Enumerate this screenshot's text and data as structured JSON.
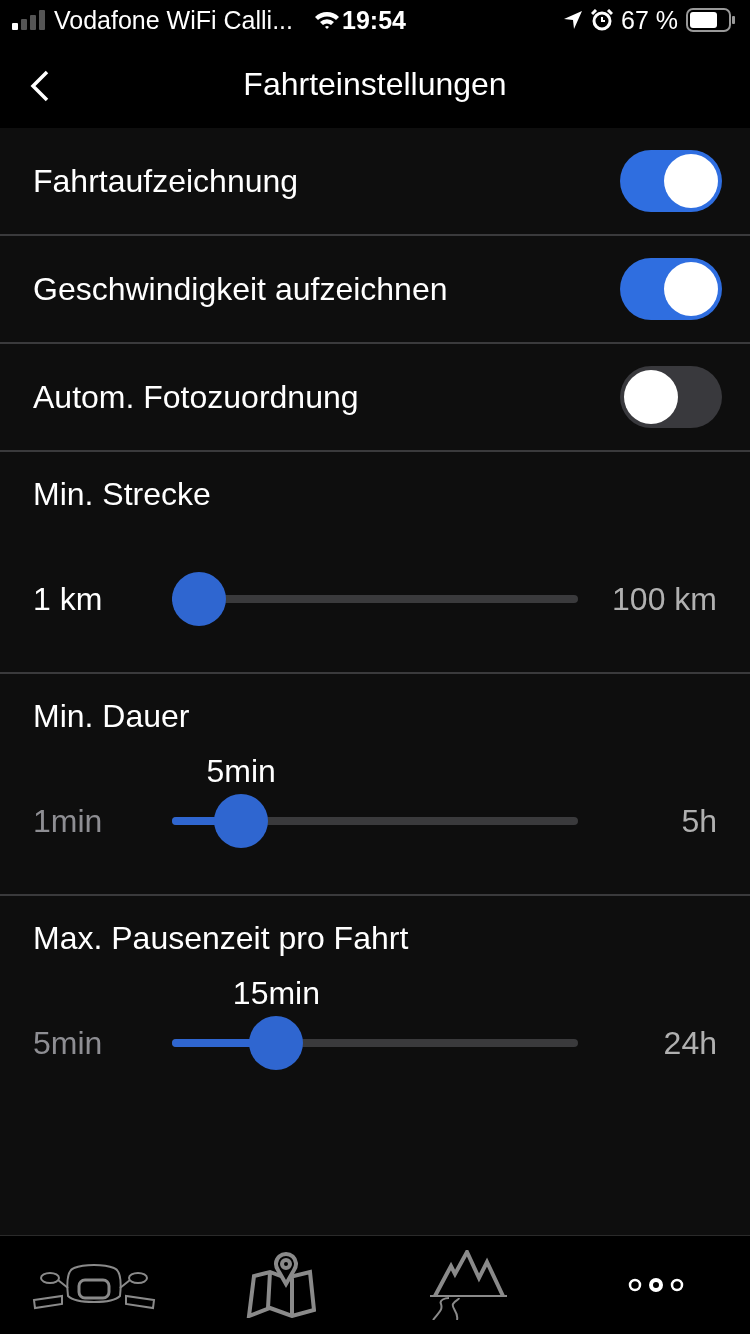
{
  "status_bar": {
    "carrier": "Vodafone WiFi Calli...",
    "time": "19:54",
    "battery": "67 %"
  },
  "nav": {
    "title": "Fahrteinstellungen"
  },
  "toggles": [
    {
      "label": "Fahrtaufzeichnung",
      "on": true
    },
    {
      "label": "Geschwindigkeit aufzeichnen",
      "on": true
    },
    {
      "label": "Autom. Fotozuordnung",
      "on": false
    }
  ],
  "sliders": [
    {
      "title": "Min. Strecke",
      "min": "1 km",
      "max": "100 km",
      "level": 0,
      "at_min": true
    },
    {
      "title": "Min. Dauer",
      "value": "5min",
      "min": "1min",
      "max": "5h",
      "level": 0.12,
      "at_min": false
    },
    {
      "title": "Max. Pausenzeit pro Fahrt",
      "value": "15min",
      "min": "5min",
      "max": "24h",
      "level": 0.22,
      "at_min": false
    }
  ],
  "tabs": [
    {
      "kind": "bike",
      "selected": false
    },
    {
      "kind": "map",
      "selected": false
    },
    {
      "kind": "tours",
      "selected": false
    },
    {
      "kind": "more",
      "selected": true
    }
  ]
}
